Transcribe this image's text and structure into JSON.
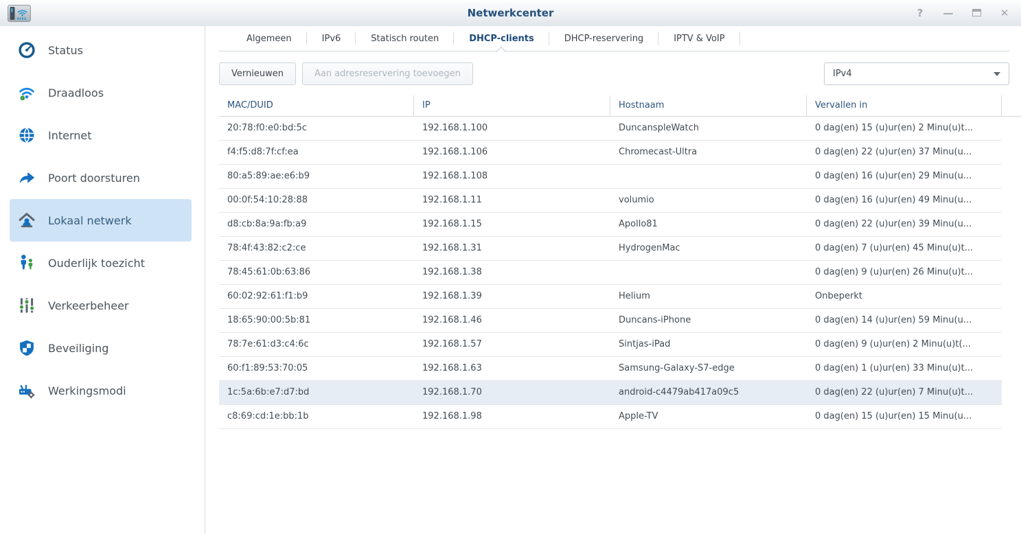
{
  "window": {
    "title": "Netwerkcenter",
    "controls": {
      "help": "?",
      "minimize": "—",
      "close": "✕"
    }
  },
  "sidebar": {
    "items": [
      {
        "label": "Status",
        "icon": "gauge-icon",
        "selected": false
      },
      {
        "label": "Draadloos",
        "icon": "wifi-icon",
        "selected": false
      },
      {
        "label": "Internet",
        "icon": "globe-icon",
        "selected": false
      },
      {
        "label": "Poort doorsturen",
        "icon": "port-forward-icon",
        "selected": false
      },
      {
        "label": "Lokaal netwerk",
        "icon": "home-icon",
        "selected": true
      },
      {
        "label": "Ouderlijk toezicht",
        "icon": "parental-control-icon",
        "selected": false
      },
      {
        "label": "Verkeerbeheer",
        "icon": "traffic-sliders-icon",
        "selected": false
      },
      {
        "label": "Beveiliging",
        "icon": "shield-icon",
        "selected": false
      },
      {
        "label": "Werkingsmodi",
        "icon": "router-gear-icon",
        "selected": false
      }
    ]
  },
  "tabs": [
    {
      "label": "Algemeen",
      "active": false
    },
    {
      "label": "IPv6",
      "active": false
    },
    {
      "label": "Statisch routen",
      "active": false
    },
    {
      "label": "DHCP-clients",
      "active": true
    },
    {
      "label": "DHCP-reservering",
      "active": false
    },
    {
      "label": "IPTV & VoIP",
      "active": false
    }
  ],
  "toolbar": {
    "refresh_label": "Vernieuwen",
    "add_reservation_label": "Aan adresreservering toevoegen",
    "ip_version_select": {
      "value": "IPv4"
    }
  },
  "table": {
    "columns": [
      "MAC/DUID",
      "IP",
      "Hostnaam",
      "Vervallen in"
    ],
    "rows": [
      {
        "mac": "20:78:f0:e0:bd:5c",
        "ip": "192.168.1.100",
        "hostname": "DuncanspleWatch",
        "expires": "0 dag(en) 15 (u)ur(en) 2 Minu(u)t...",
        "highlighted": false
      },
      {
        "mac": "f4:f5:d8:7f:cf:ea",
        "ip": "192.168.1.106",
        "hostname": "Chromecast-Ultra",
        "expires": "0 dag(en) 22 (u)ur(en) 37 Minu(u...",
        "highlighted": false
      },
      {
        "mac": "80:a5:89:ae:e6:b9",
        "ip": "192.168.1.108",
        "hostname": "",
        "expires": "0 dag(en) 16 (u)ur(en) 29 Minu(u...",
        "highlighted": false
      },
      {
        "mac": "00:0f:54:10:28:88",
        "ip": "192.168.1.11",
        "hostname": "volumio",
        "expires": "0 dag(en) 16 (u)ur(en) 49 Minu(u...",
        "highlighted": false
      },
      {
        "mac": "d8:cb:8a:9a:fb:a9",
        "ip": "192.168.1.15",
        "hostname": "Apollo81",
        "expires": "0 dag(en) 22 (u)ur(en) 39 Minu(u...",
        "highlighted": false
      },
      {
        "mac": "78:4f:43:82:c2:ce",
        "ip": "192.168.1.31",
        "hostname": "HydrogenMac",
        "expires": "0 dag(en) 7 (u)ur(en) 45 Minu(u)t...",
        "highlighted": false
      },
      {
        "mac": "78:45:61:0b:63:86",
        "ip": "192.168.1.38",
        "hostname": "",
        "expires": "0 dag(en) 9 (u)ur(en) 26 Minu(u)t...",
        "highlighted": false
      },
      {
        "mac": "60:02:92:61:f1:b9",
        "ip": "192.168.1.39",
        "hostname": "Helium",
        "expires": "Onbeperkt",
        "highlighted": false
      },
      {
        "mac": "18:65:90:00:5b:81",
        "ip": "192.168.1.46",
        "hostname": "Duncans-iPhone",
        "expires": "0 dag(en) 14 (u)ur(en) 59 Minu(u...",
        "highlighted": false
      },
      {
        "mac": "78:7e:61:d3:c4:6c",
        "ip": "192.168.1.57",
        "hostname": "Sintjas-iPad",
        "expires": "0 dag(en) 9 (u)ur(en) 2 Minu(u)t(...",
        "highlighted": false
      },
      {
        "mac": "60:f1:89:53:70:05",
        "ip": "192.168.1.63",
        "hostname": "Samsung-Galaxy-S7-edge",
        "expires": "0 dag(en) 1 (u)ur(en) 33 Minu(u)t...",
        "highlighted": false
      },
      {
        "mac": "1c:5a:6b:e7:d7:bd",
        "ip": "192.168.1.70",
        "hostname": "android-c4479ab417a09c5",
        "expires": "0 dag(en) 22 (u)ur(en) 7 Minu(u)t...",
        "highlighted": true
      },
      {
        "mac": "c8:69:cd:1e:bb:1b",
        "ip": "192.168.1.98",
        "hostname": "Apple-TV",
        "expires": "0 dag(en) 15 (u)ur(en) 15 Minu(u...",
        "highlighted": false
      }
    ]
  },
  "colors": {
    "accent_blue": "#1470c0",
    "title_text": "#27517d",
    "active_tab_text": "#1c4c7c",
    "selected_sidebar_bg": "#cfe3f6",
    "highlighted_row_bg": "#e6edf4",
    "header_text": "#2c557f",
    "green_accent": "#43a047"
  }
}
